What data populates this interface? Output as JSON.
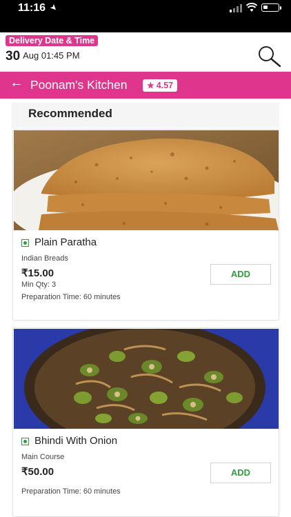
{
  "status_bar": {
    "time": "11:16"
  },
  "delivery": {
    "badge_label": "Delivery Date & Time",
    "day": "30",
    "month_time": "Aug 01:45 PM"
  },
  "restaurant": {
    "name": "Poonam's Kitchen",
    "rating": "4.57"
  },
  "section": {
    "title": "Recommended"
  },
  "items": [
    {
      "name": "Plain Paratha",
      "category": "Indian Breads",
      "price": "₹15.00",
      "min_qty": "Min Qty: 3",
      "prep_time": "Preparation Time: 60 minutes",
      "add_label": "ADD",
      "veg": true
    },
    {
      "name": "Bhindi With Onion",
      "category": "Main Course",
      "price": "₹50.00",
      "prep_time": "Preparation Time: 60 minutes",
      "add_label": "ADD",
      "veg": true
    }
  ],
  "colors": {
    "brand_pink": "#e0358c",
    "veg_green": "#2e9e3e",
    "add_green": "#2e9e3e"
  },
  "icons": {
    "location_arrow": "location-arrow-icon",
    "signal": "cellular-signal-icon",
    "wifi": "wifi-icon",
    "battery": "battery-icon",
    "search": "search-icon",
    "back": "back-arrow-icon",
    "star": "star-icon",
    "veg": "veg-indicator-icon"
  }
}
